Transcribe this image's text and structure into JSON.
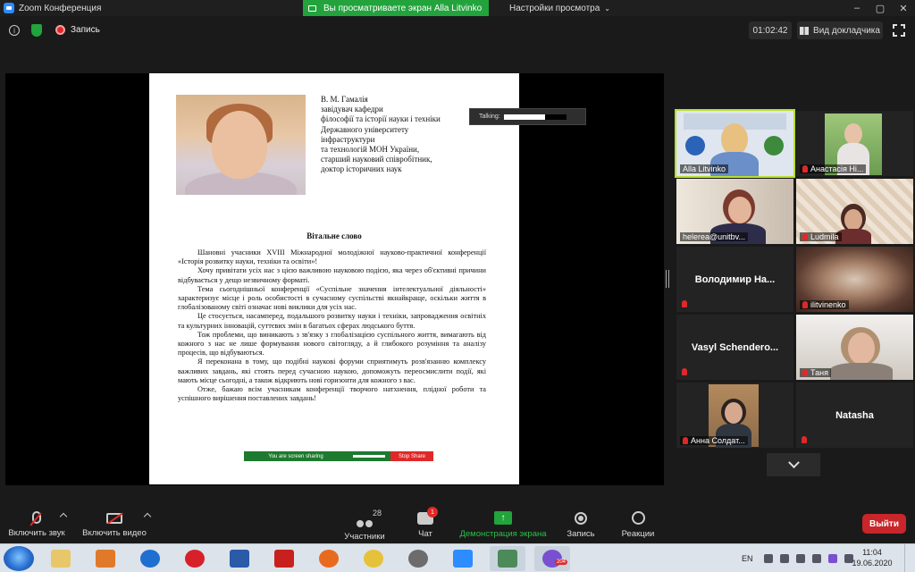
{
  "window": {
    "title": "Zoom Конференция",
    "share_banner": "Вы просматриваете экран Alla Litvinko",
    "view_options": "Настройки просмотра"
  },
  "top_bar": {
    "record_label": "Запись",
    "timer": "01:02:42",
    "view_mode": "Вид докладчика"
  },
  "shared_doc": {
    "author_lines": [
      "В. М. Гамалія",
      "завідувач кафедри",
      "філософії та історії науки і техніки",
      "Державного університету",
      "інфраструктури",
      "та технологій МОН України,",
      "старший науковий співробітник,",
      "доктор історичних наук"
    ],
    "title": "Вітальне слово",
    "paragraphs": [
      "Шановні учасники XVIII Міжнародної молодіжної науково-практичної конференції «Історія розвитку науки, техніки та освіти»!",
      "Хочу привітати усіх нас з цією важливою науковою подією, яка через об'єктивні причини відбувається у дещо незвичному форматі.",
      "Тема сьогоднішньої конференції «Суспільне значення інтелектуальної діяльності» характеризує місце і роль особистості в сучасному суспільстві якнайкраще, оскільки життя в глобалізованому світі означає нові виклики для усіх нас.",
      "Це стосується, насамперед, подальшого розвитку науки і техніки, запровадження освітніх та культурних інновацій, суттєвих змін в багатьох сферах людського буття.",
      "Тож проблеми, що виникають з зв'язку з глобалізацією суспільного життя, вимагають від кожного з нас не лише формування нового світогляду, а й глибокого розуміння та аналізу процесів, що відбуваються.",
      "Я переконана в тому, що подібні наукові форуми сприятимуть розв'язанню комплексу важливих завдань, які стоять перед сучасною наукою, допоможуть переосмислити події, які мають місце сьогодні, а також відкриють нові горизонти для кожного з вас.",
      "Отже, бажаю всім учасникам конференції творчого натхнення, плідної роботи та успішного вирішення поставлених завдань!"
    ],
    "sharing_text": "You are screen sharing",
    "stop_share": "Stop Share",
    "talking_label": "Talking:"
  },
  "participants": [
    {
      "name": "Alla Litvinko",
      "kind": "video",
      "active": true,
      "muted": false
    },
    {
      "name": "Анастасія Ні...",
      "kind": "video",
      "muted": true
    },
    {
      "name": "helerea@unitbv...",
      "kind": "video",
      "muted": false
    },
    {
      "name": "Ludmila",
      "kind": "video",
      "muted": true
    },
    {
      "name": "Володимир На...",
      "kind": "name",
      "muted": true
    },
    {
      "name": "ilitvinenko",
      "kind": "video",
      "muted": true
    },
    {
      "name": "Vasyl Schendero...",
      "kind": "name",
      "muted": true
    },
    {
      "name": "Таня",
      "kind": "video",
      "muted": true
    },
    {
      "name": "Анна Солдат...",
      "kind": "video",
      "muted": true
    },
    {
      "name": "Natasha",
      "kind": "name",
      "muted": true
    }
  ],
  "toolbar": {
    "unmute": "Включить звук",
    "start_video": "Включить видео",
    "participants": "Участники",
    "participants_count": "28",
    "chat": "Чат",
    "chat_badge": "1",
    "share_screen": "Демонстрация экрана",
    "record": "Запись",
    "reactions": "Реакции",
    "leave": "Выйти"
  },
  "taskbar": {
    "language": "EN",
    "time": "11:04",
    "date": "19.06.2020",
    "viber_badge": "204"
  },
  "colors": {
    "share_green": "#22a33c",
    "leave_red": "#c8262a",
    "active_speaker": "#b8df2e"
  }
}
